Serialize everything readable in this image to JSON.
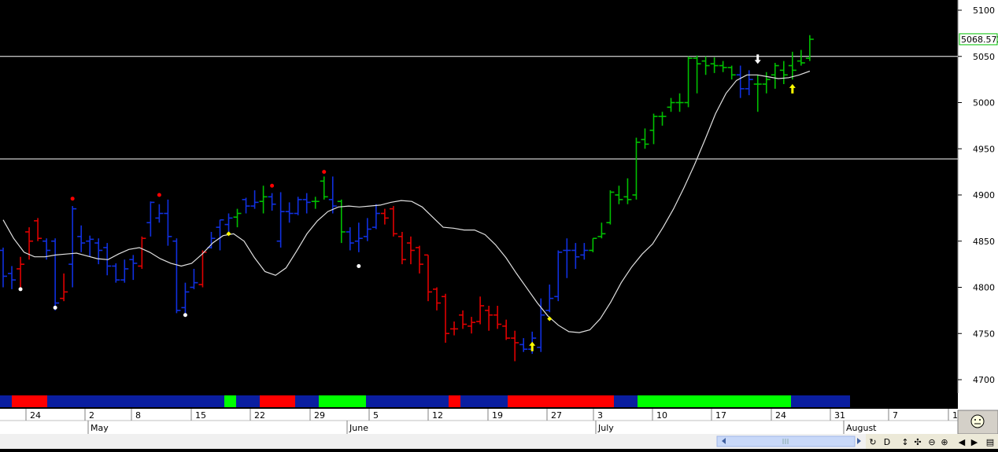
{
  "colors": {
    "background": "#000000",
    "up_bar": "#00c000",
    "down_bar": "#e00000",
    "neutral_bar": "#1030e0",
    "moving_average": "#e0e0e0",
    "horizontal_line": "#ffffff",
    "dot_red": "#ff0000",
    "dot_white": "#ffffff",
    "dot_yellow": "#ffff00",
    "arrow_yellow": "#ffff00",
    "arrow_white": "#ffffff",
    "last_price": "#00c000"
  },
  "price_label": "5068.572",
  "dates": {
    "days": [
      "24",
      "2",
      "8",
      "15",
      "22",
      "29",
      "5",
      "12",
      "19",
      "27",
      "3",
      "10",
      "17",
      "24",
      "31",
      "7",
      "1"
    ],
    "months": [
      "May",
      "June",
      "July",
      "August"
    ]
  },
  "toolbar_icons": [
    "arrow-left-icon",
    "arrow-right-icon",
    "cycle-icon",
    "D",
    "move-vertical-icon",
    "move-icon",
    "zoom-out-icon",
    "zoom-in-icon",
    "page-icon"
  ],
  "chart_data": {
    "type": "ohlc",
    "title": "",
    "ylim": [
      4690,
      5110
    ],
    "yticks": [
      4700,
      4750,
      4800,
      4850,
      4900,
      4950,
      5000,
      5050,
      5100
    ],
    "horizontal_lines": [
      5050,
      4939
    ],
    "last_price": 5068.572,
    "bar_colors_legend": [
      "up",
      "down",
      "neutral"
    ],
    "bars": [
      {
        "o": 4840,
        "h": 4843,
        "l": 4800,
        "c": 4812,
        "col": "neutral"
      },
      {
        "o": 4815,
        "h": 4823,
        "l": 4798,
        "c": 4808,
        "col": "neutral"
      },
      {
        "o": 4820,
        "h": 4833,
        "l": 4800,
        "c": 4825,
        "col": "down"
      },
      {
        "o": 4860,
        "h": 4865,
        "l": 4830,
        "c": 4850,
        "col": "down"
      },
      {
        "o": 4872,
        "h": 4875,
        "l": 4850,
        "c": 4853,
        "col": "down"
      },
      {
        "o": 4850,
        "h": 4853,
        "l": 4830,
        "c": 4840,
        "col": "neutral"
      },
      {
        "o": 4850,
        "h": 4853,
        "l": 4775,
        "c": 4783,
        "col": "neutral"
      },
      {
        "o": 4788,
        "h": 4815,
        "l": 4785,
        "c": 4795,
        "col": "down"
      },
      {
        "o": 4825,
        "h": 4888,
        "l": 4800,
        "c": 4885,
        "col": "neutral"
      },
      {
        "o": 4855,
        "h": 4867,
        "l": 4838,
        "c": 4848,
        "col": "neutral"
      },
      {
        "o": 4850,
        "h": 4856,
        "l": 4833,
        "c": 4852,
        "col": "neutral"
      },
      {
        "o": 4848,
        "h": 4853,
        "l": 4825,
        "c": 4840,
        "col": "neutral"
      },
      {
        "o": 4843,
        "h": 4848,
        "l": 4813,
        "c": 4823,
        "col": "neutral"
      },
      {
        "o": 4823,
        "h": 4826,
        "l": 4805,
        "c": 4808,
        "col": "neutral"
      },
      {
        "o": 4808,
        "h": 4830,
        "l": 4805,
        "c": 4820,
        "col": "neutral"
      },
      {
        "o": 4830,
        "h": 4835,
        "l": 4808,
        "c": 4826,
        "col": "neutral"
      },
      {
        "o": 4823,
        "h": 4855,
        "l": 4820,
        "c": 4853,
        "col": "down"
      },
      {
        "o": 4870,
        "h": 4893,
        "l": 4855,
        "c": 4892,
        "col": "neutral"
      },
      {
        "o": 4875,
        "h": 4890,
        "l": 4870,
        "c": 4880,
        "col": "neutral"
      },
      {
        "o": 4880,
        "h": 4895,
        "l": 4845,
        "c": 4855,
        "col": "neutral"
      },
      {
        "o": 4850,
        "h": 4853,
        "l": 4772,
        "c": 4775,
        "col": "neutral"
      },
      {
        "o": 4778,
        "h": 4805,
        "l": 4772,
        "c": 4795,
        "col": "neutral"
      },
      {
        "o": 4800,
        "h": 4820,
        "l": 4798,
        "c": 4805,
        "col": "neutral"
      },
      {
        "o": 4803,
        "h": 4840,
        "l": 4800,
        "c": 4838,
        "col": "down"
      },
      {
        "o": 4843,
        "h": 4860,
        "l": 4842,
        "c": 4853,
        "col": "neutral"
      },
      {
        "o": 4865,
        "h": 4873,
        "l": 4840,
        "c": 4873,
        "col": "neutral"
      },
      {
        "o": 4868,
        "h": 4880,
        "l": 4860,
        "c": 4875,
        "col": "neutral"
      },
      {
        "o": 4876,
        "h": 4885,
        "l": 4865,
        "c": 4880,
        "col": "up"
      },
      {
        "o": 4895,
        "h": 4897,
        "l": 4880,
        "c": 4888,
        "col": "neutral"
      },
      {
        "o": 4888,
        "h": 4905,
        "l": 4885,
        "c": 4892,
        "col": "neutral"
      },
      {
        "o": 4893,
        "h": 4910,
        "l": 4880,
        "c": 4898,
        "col": "up"
      },
      {
        "o": 4898,
        "h": 4902,
        "l": 4883,
        "c": 4890,
        "col": "neutral"
      },
      {
        "o": 4850,
        "h": 4903,
        "l": 4843,
        "c": 4882,
        "col": "neutral"
      },
      {
        "o": 4882,
        "h": 4892,
        "l": 4870,
        "c": 4880,
        "col": "neutral"
      },
      {
        "o": 4880,
        "h": 4898,
        "l": 4878,
        "c": 4895,
        "col": "neutral"
      },
      {
        "o": 4895,
        "h": 4902,
        "l": 4880,
        "c": 4892,
        "col": "neutral"
      },
      {
        "o": 4893,
        "h": 4898,
        "l": 4885,
        "c": 4893,
        "col": "up"
      },
      {
        "o": 4915,
        "h": 4920,
        "l": 4895,
        "c": 4898,
        "col": "up"
      },
      {
        "o": 4895,
        "h": 4920,
        "l": 4880,
        "c": 4888,
        "col": "neutral"
      },
      {
        "o": 4893,
        "h": 4895,
        "l": 4848,
        "c": 4860,
        "col": "up"
      },
      {
        "o": 4860,
        "h": 4865,
        "l": 4840,
        "c": 4848,
        "col": "neutral"
      },
      {
        "o": 4850,
        "h": 4870,
        "l": 4838,
        "c": 4853,
        "col": "neutral"
      },
      {
        "o": 4855,
        "h": 4875,
        "l": 4850,
        "c": 4863,
        "col": "neutral"
      },
      {
        "o": 4865,
        "h": 4890,
        "l": 4863,
        "c": 4880,
        "col": "neutral"
      },
      {
        "o": 4880,
        "h": 4885,
        "l": 4868,
        "c": 4875,
        "col": "down"
      },
      {
        "o": 4885,
        "h": 4888,
        "l": 4855,
        "c": 4858,
        "col": "down"
      },
      {
        "o": 4855,
        "h": 4860,
        "l": 4825,
        "c": 4830,
        "col": "down"
      },
      {
        "o": 4848,
        "h": 4855,
        "l": 4825,
        "c": 4840,
        "col": "down"
      },
      {
        "o": 4843,
        "h": 4845,
        "l": 4815,
        "c": 4825,
        "col": "down"
      },
      {
        "o": 4835,
        "h": 4835,
        "l": 4785,
        "c": 4795,
        "col": "down"
      },
      {
        "o": 4798,
        "h": 4800,
        "l": 4775,
        "c": 4783,
        "col": "down"
      },
      {
        "o": 4790,
        "h": 4793,
        "l": 4740,
        "c": 4750,
        "col": "down"
      },
      {
        "o": 4755,
        "h": 4763,
        "l": 4748,
        "c": 4755,
        "col": "down"
      },
      {
        "o": 4770,
        "h": 4775,
        "l": 4755,
        "c": 4760,
        "col": "down"
      },
      {
        "o": 4758,
        "h": 4768,
        "l": 4750,
        "c": 4762,
        "col": "down"
      },
      {
        "o": 4763,
        "h": 4790,
        "l": 4760,
        "c": 4780,
        "col": "down"
      },
      {
        "o": 4775,
        "h": 4780,
        "l": 4753,
        "c": 4770,
        "col": "down"
      },
      {
        "o": 4770,
        "h": 4780,
        "l": 4755,
        "c": 4760,
        "col": "down"
      },
      {
        "o": 4758,
        "h": 4765,
        "l": 4743,
        "c": 4745,
        "col": "down"
      },
      {
        "o": 4745,
        "h": 4753,
        "l": 4720,
        "c": 4740,
        "col": "down"
      },
      {
        "o": 4738,
        "h": 4745,
        "l": 4730,
        "c": 4733,
        "col": "neutral"
      },
      {
        "o": 4733,
        "h": 4752,
        "l": 4728,
        "c": 4745,
        "col": "neutral"
      },
      {
        "o": 4735,
        "h": 4788,
        "l": 4730,
        "c": 4770,
        "col": "neutral"
      },
      {
        "o": 4775,
        "h": 4803,
        "l": 4773,
        "c": 4788,
        "col": "neutral"
      },
      {
        "o": 4790,
        "h": 4840,
        "l": 4785,
        "c": 4838,
        "col": "neutral"
      },
      {
        "o": 4840,
        "h": 4853,
        "l": 4810,
        "c": 4840,
        "col": "neutral"
      },
      {
        "o": 4840,
        "h": 4848,
        "l": 4820,
        "c": 4833,
        "col": "neutral"
      },
      {
        "o": 4835,
        "h": 4848,
        "l": 4830,
        "c": 4840,
        "col": "neutral"
      },
      {
        "o": 4840,
        "h": 4853,
        "l": 4838,
        "c": 4853,
        "col": "up"
      },
      {
        "o": 4855,
        "h": 4870,
        "l": 4853,
        "c": 4858,
        "col": "up"
      },
      {
        "o": 4870,
        "h": 4905,
        "l": 4868,
        "c": 4903,
        "col": "up"
      },
      {
        "o": 4900,
        "h": 4910,
        "l": 4890,
        "c": 4895,
        "col": "up"
      },
      {
        "o": 4898,
        "h": 4918,
        "l": 4890,
        "c": 4895,
        "col": "up"
      },
      {
        "o": 4900,
        "h": 4962,
        "l": 4895,
        "c": 4957,
        "col": "up"
      },
      {
        "o": 4960,
        "h": 4972,
        "l": 4950,
        "c": 4955,
        "col": "up"
      },
      {
        "o": 4970,
        "h": 4988,
        "l": 4955,
        "c": 4985,
        "col": "up"
      },
      {
        "o": 4985,
        "h": 4990,
        "l": 4975,
        "c": 4985,
        "col": "up"
      },
      {
        "o": 4995,
        "h": 5005,
        "l": 4990,
        "c": 5000,
        "col": "up"
      },
      {
        "o": 5000,
        "h": 5010,
        "l": 4990,
        "c": 5000,
        "col": "up"
      },
      {
        "o": 5000,
        "h": 5050,
        "l": 4995,
        "c": 5048,
        "col": "up"
      },
      {
        "o": 5048,
        "h": 5051,
        "l": 5010,
        "c": 5042,
        "col": "up"
      },
      {
        "o": 5045,
        "h": 5050,
        "l": 5030,
        "c": 5040,
        "col": "up"
      },
      {
        "o": 5042,
        "h": 5049,
        "l": 5032,
        "c": 5040,
        "col": "up"
      },
      {
        "o": 5040,
        "h": 5045,
        "l": 5033,
        "c": 5038,
        "col": "up"
      },
      {
        "o": 5038,
        "h": 5040,
        "l": 5025,
        "c": 5030,
        "col": "up"
      },
      {
        "o": 5030,
        "h": 5040,
        "l": 5005,
        "c": 5015,
        "col": "neutral"
      },
      {
        "o": 5015,
        "h": 5035,
        "l": 5008,
        "c": 5025,
        "col": "neutral"
      },
      {
        "o": 5020,
        "h": 5030,
        "l": 4990,
        "c": 5020,
        "col": "up"
      },
      {
        "o": 5020,
        "h": 5033,
        "l": 5010,
        "c": 5025,
        "col": "up"
      },
      {
        "o": 5030,
        "h": 5043,
        "l": 5015,
        "c": 5040,
        "col": "up"
      },
      {
        "o": 5035,
        "h": 5045,
        "l": 5020,
        "c": 5030,
        "col": "up"
      },
      {
        "o": 5040,
        "h": 5055,
        "l": 5025,
        "c": 5035,
        "col": "up"
      },
      {
        "o": 5045,
        "h": 5057,
        "l": 5040,
        "c": 5043,
        "col": "up"
      },
      {
        "o": 5048,
        "h": 5073,
        "l": 5045,
        "c": 5068.572,
        "col": "up"
      }
    ],
    "moving_average": [
      4873,
      4853,
      4838,
      4833,
      4833,
      4835,
      4836,
      4837,
      4834,
      4831,
      4830,
      4836,
      4841,
      4843,
      4838,
      4831,
      4826,
      4823,
      4826,
      4836,
      4848,
      4856,
      4858,
      4850,
      4832,
      4817,
      4813,
      4821,
      4839,
      4858,
      4872,
      4882,
      4887,
      4888,
      4887,
      4888,
      4889,
      4892,
      4894,
      4893,
      4887,
      4876,
      4865,
      4864,
      4862,
      4862,
      4857,
      4846,
      4832,
      4815,
      4799,
      4783,
      4769,
      4759,
      4752,
      4751,
      4754,
      4766,
      4784,
      4805,
      4822,
      4836,
      4847,
      4865,
      4885,
      4908,
      4933,
      4960,
      4988,
      5010,
      5024,
      5030,
      5030,
      5028,
      5026,
      5027,
      5030,
      5034
    ],
    "ma_start_bar": 0,
    "ma_x_start_frac": 0,
    "high_markers": [
      {
        "bar": 8,
        "price": 4896,
        "color": "red"
      },
      {
        "bar": 18,
        "price": 4900,
        "color": "red"
      },
      {
        "bar": 31,
        "price": 4910,
        "color": "red"
      },
      {
        "bar": 37,
        "price": 4925,
        "color": "red"
      }
    ],
    "low_markers": [
      {
        "bar": 2,
        "price": 4798,
        "color": "white"
      },
      {
        "bar": 6,
        "price": 4778,
        "color": "white"
      },
      {
        "bar": 21,
        "price": 4770,
        "color": "white"
      },
      {
        "bar": 41,
        "price": 4823,
        "color": "white"
      }
    ],
    "diamond_markers": [
      {
        "bar": 26,
        "price": 4858,
        "color": "yellow"
      },
      {
        "bar": 63,
        "price": 4766,
        "color": "yellow"
      }
    ],
    "arrows": [
      {
        "bar": 61,
        "price": 4736,
        "direction": "up",
        "color": "yellow"
      },
      {
        "bar": 87,
        "price": 5047,
        "direction": "down",
        "color": "white"
      },
      {
        "bar": 91,
        "price": 5015,
        "direction": "up",
        "color": "yellow"
      }
    ],
    "ribbon": [
      {
        "from": 0,
        "to": 1,
        "color": "neutral"
      },
      {
        "from": 1,
        "to": 4,
        "color": "down"
      },
      {
        "from": 4,
        "to": 19,
        "color": "neutral"
      },
      {
        "from": 19,
        "to": 20,
        "color": "up"
      },
      {
        "from": 20,
        "to": 22,
        "color": "neutral"
      },
      {
        "from": 22,
        "to": 25,
        "color": "down"
      },
      {
        "from": 25,
        "to": 27,
        "color": "neutral"
      },
      {
        "from": 27,
        "to": 31,
        "color": "up"
      },
      {
        "from": 31,
        "to": 38,
        "color": "neutral"
      },
      {
        "from": 38,
        "to": 39,
        "color": "down"
      },
      {
        "from": 39,
        "to": 43,
        "color": "neutral"
      },
      {
        "from": 43,
        "to": 52,
        "color": "down"
      },
      {
        "from": 52,
        "to": 54,
        "color": "neutral"
      },
      {
        "from": 54,
        "to": 67,
        "color": "up"
      },
      {
        "from": 67,
        "to": 72,
        "color": "neutral"
      }
    ]
  }
}
